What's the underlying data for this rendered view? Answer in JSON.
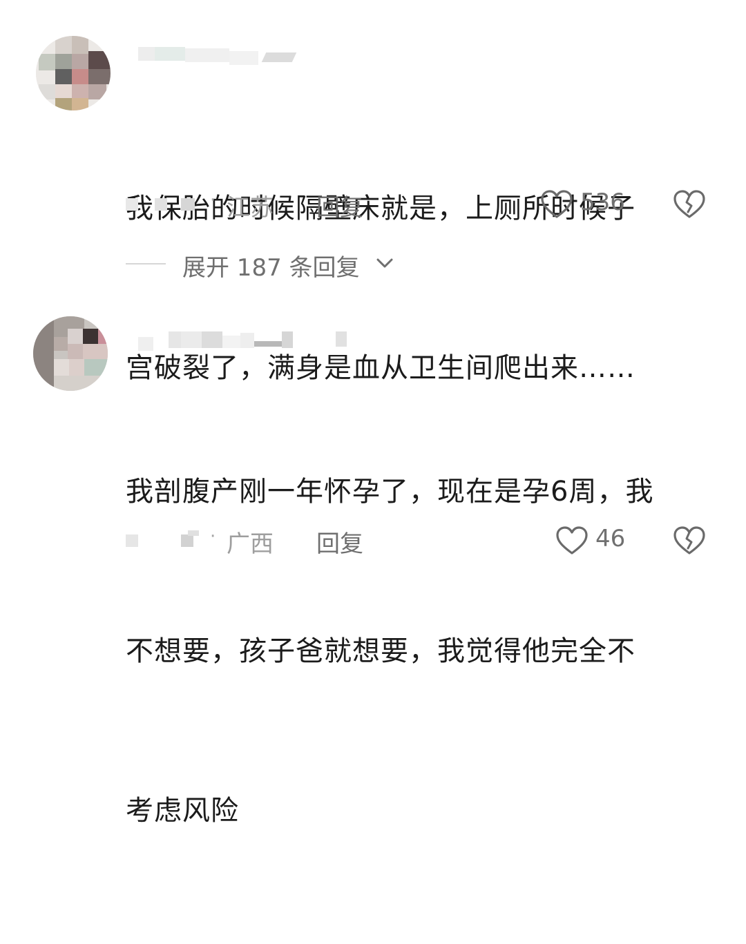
{
  "comments": [
    {
      "text_line1": "我保胎的时候隔壁床就是，上厕所时候子",
      "text_line2": "宫破裂了，满身是血从卫生间爬出来……",
      "separator": "·",
      "location": "江苏",
      "reply_label": "回复",
      "like_count": "536",
      "expand_replies_label": "展开 187 条回复"
    },
    {
      "text_line1": "我剖腹产刚一年怀孕了，现在是孕6周，我",
      "text_line2": "不想要，孩子爸就想要，我觉得他完全不",
      "text_line3": "考虑风险",
      "separator": "·",
      "location": "广西",
      "reply_label": "回复",
      "like_count": "46"
    }
  ],
  "icons": {
    "like": "heart-outline-icon",
    "dislike": "broken-heart-icon",
    "expand": "chevron-down-icon"
  },
  "colors": {
    "text": "#1b1b1b",
    "meta": "#9e9e9e",
    "reply": "#6f6f6f",
    "icon": "#6a6a6a"
  }
}
